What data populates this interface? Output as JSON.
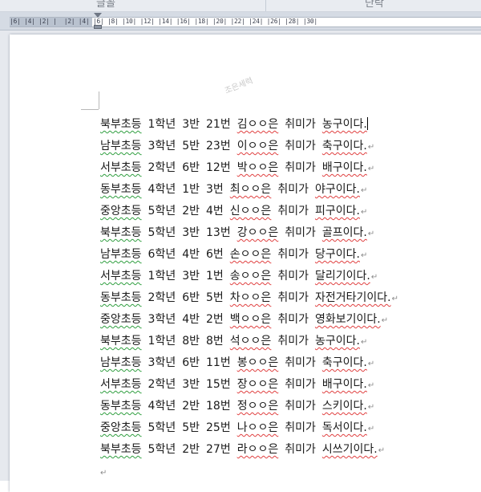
{
  "ribbon": {
    "group_left": "글꼴",
    "group_right": "단락"
  },
  "ruler": {
    "numbers": "|6| |4| |2| |  |2| |4| |6| |8| |10| |12| |14| |16| |18| |20| |22| |24| |26| |28| |30|"
  },
  "document": {
    "watermark": "조은세력",
    "paragraph_mark": "↵",
    "lines": [
      {
        "school": "북부초등",
        "grade": "1학년",
        "cls": "3반",
        "num": "21번",
        "name": "김ㅇㅇ은",
        "verb": "취미가",
        "hobby": "농구이다."
      },
      {
        "school": "남부초등",
        "grade": "3학년",
        "cls": "5반",
        "num": "23번",
        "name": "이ㅇㅇ은",
        "verb": "취미가",
        "hobby": "축구이다."
      },
      {
        "school": "서부초등",
        "grade": "2학년",
        "cls": "6반",
        "num": "12번",
        "name": "박ㅇㅇ은",
        "verb": "취미가",
        "hobby": "배구이다."
      },
      {
        "school": "동부초등",
        "grade": "4학년",
        "cls": "1반",
        "num": "3번",
        "name": "최ㅇㅇ은",
        "verb": "취미가",
        "hobby": "야구이다."
      },
      {
        "school": "중앙초등",
        "grade": "5학년",
        "cls": "2반",
        "num": "4번",
        "name": "신ㅇㅇ은",
        "verb": "취미가",
        "hobby": "피구이다."
      },
      {
        "school": "북부초등",
        "grade": "5학년",
        "cls": "3반",
        "num": "13번",
        "name": "강ㅇㅇ은",
        "verb": "취미가",
        "hobby": "골프이다."
      },
      {
        "school": "남부초등",
        "grade": "6학년",
        "cls": "4반",
        "num": "6번",
        "name": "손ㅇㅇ은",
        "verb": "취미가",
        "hobby": "당구이다."
      },
      {
        "school": "서부초등",
        "grade": "1학년",
        "cls": "3반",
        "num": "1번",
        "name": "송ㅇㅇ은",
        "verb": "취미가",
        "hobby": "달리기이다."
      },
      {
        "school": "동부초등",
        "grade": "2학년",
        "cls": "6반",
        "num": "5번",
        "name": "차ㅇㅇ은",
        "verb": "취미가",
        "hobby": "자전거타기이다."
      },
      {
        "school": "중앙초등",
        "grade": "3학년",
        "cls": "4반",
        "num": "2번",
        "name": "백ㅇㅇ은",
        "verb": "취미가",
        "hobby": "영화보기이다."
      },
      {
        "school": "북부초등",
        "grade": "1학년",
        "cls": "8반",
        "num": "8번",
        "name": "석ㅇㅇ은",
        "verb": "취미가",
        "hobby": "농구이다."
      },
      {
        "school": "남부초등",
        "grade": "3학년",
        "cls": "6반",
        "num": "11번",
        "name": "봉ㅇㅇ은",
        "verb": "취미가",
        "hobby": "축구이다."
      },
      {
        "school": "서부초등",
        "grade": "2학년",
        "cls": "3반",
        "num": "15번",
        "name": "장ㅇㅇ은",
        "verb": "취미가",
        "hobby": "배구이다."
      },
      {
        "school": "동부초등",
        "grade": "4학년",
        "cls": "2반",
        "num": "18번",
        "name": "정ㅇㅇ은",
        "verb": "취미가",
        "hobby": "스키이다."
      },
      {
        "school": "중앙초등",
        "grade": "5학년",
        "cls": "5반",
        "num": "25번",
        "name": "나ㅇㅇ은",
        "verb": "취미가",
        "hobby": "독서이다."
      },
      {
        "school": "북부초등",
        "grade": "5학년",
        "cls": "2반",
        "num": "27번",
        "name": "라ㅇㅇ은",
        "verb": "취미가",
        "hobby": "시쓰기이다."
      }
    ]
  }
}
